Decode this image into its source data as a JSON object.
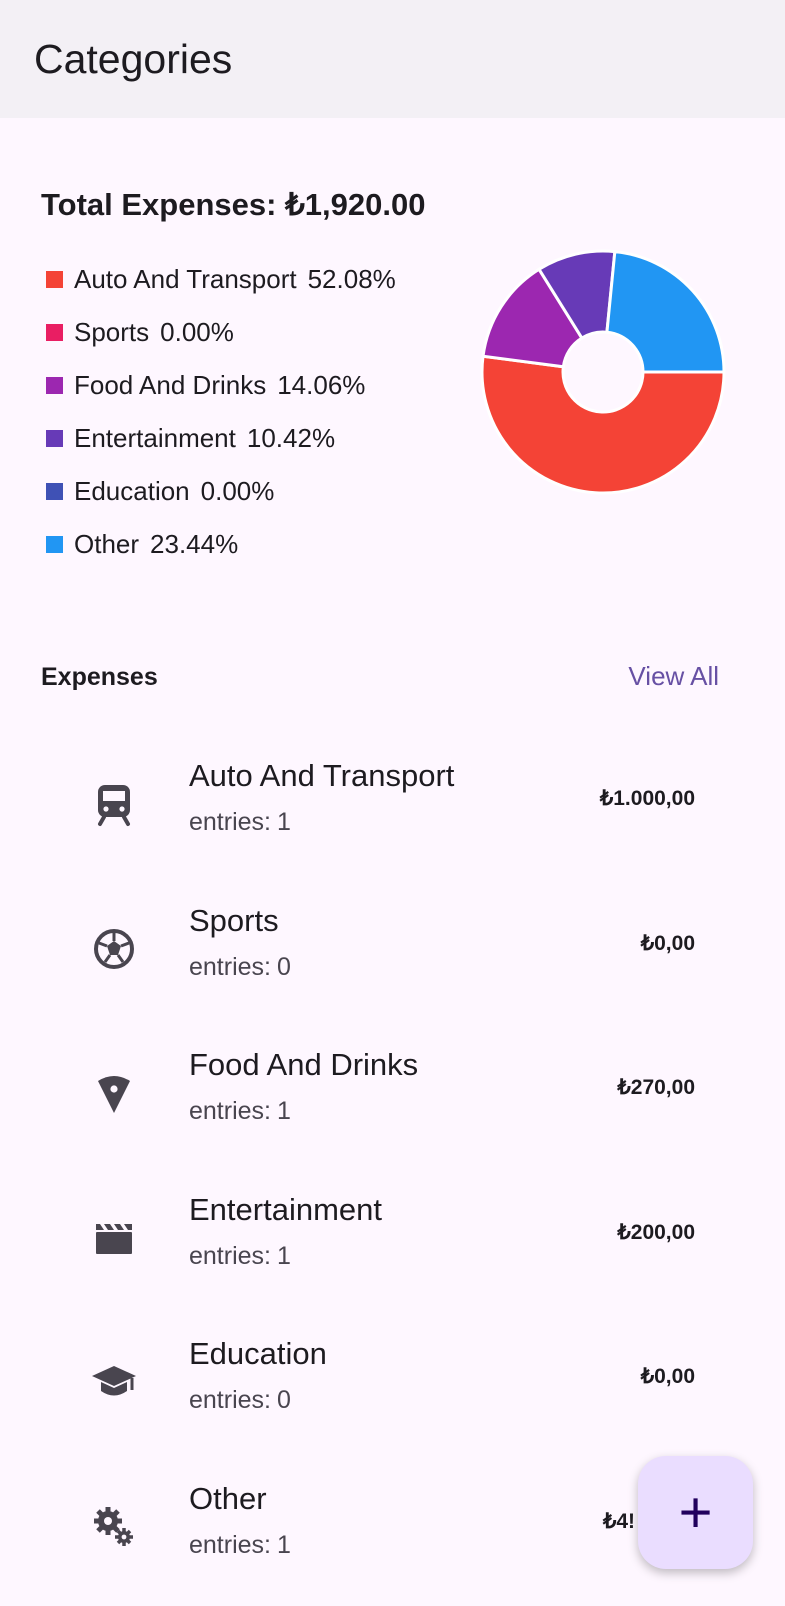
{
  "app_bar": {
    "title": "Categories"
  },
  "summary": {
    "label": "Total Expenses:",
    "total": "₺1,920.00"
  },
  "colors": {
    "auto": "#f44336",
    "sports": "#e91e63",
    "food": "#9c27b0",
    "entertainment": "#673ab7",
    "education": "#3f51b5",
    "other": "#2196f3",
    "accent": "#6750a4",
    "fab_background": "#eaddff"
  },
  "legend": [
    {
      "name": "Auto And Transport",
      "percent": "52.08%",
      "color": "#f44336"
    },
    {
      "name": "Sports",
      "percent": "0.00%",
      "color": "#e91e63"
    },
    {
      "name": "Food And Drinks",
      "percent": "14.06%",
      "color": "#9c27b0"
    },
    {
      "name": "Entertainment",
      "percent": "10.42%",
      "color": "#673ab7"
    },
    {
      "name": "Education",
      "percent": "0.00%",
      "color": "#3f51b5"
    },
    {
      "name": "Other",
      "percent": "23.44%",
      "color": "#2196f3"
    }
  ],
  "chart_data": {
    "type": "pie",
    "categories": [
      "Auto And Transport",
      "Sports",
      "Food And Drinks",
      "Entertainment",
      "Education",
      "Other"
    ],
    "values": [
      52.08,
      0.0,
      14.06,
      10.42,
      0.0,
      23.44
    ],
    "colors": [
      "#f44336",
      "#e91e63",
      "#9c27b0",
      "#673ab7",
      "#3f51b5",
      "#2196f3"
    ],
    "hole": true,
    "legend": "left"
  },
  "expenses": {
    "title": "Expenses",
    "view_all": "View All",
    "entries_label": "entries:",
    "items": [
      {
        "name": "Auto And Transport",
        "entries": "1",
        "amount": "₺1.000,00",
        "icon": "train-icon"
      },
      {
        "name": "Sports",
        "entries": "0",
        "amount": "₺0,00",
        "icon": "soccer-ball-icon"
      },
      {
        "name": "Food And Drinks",
        "entries": "1",
        "amount": "₺270,00",
        "icon": "pizza-icon"
      },
      {
        "name": "Entertainment",
        "entries": "1",
        "amount": "₺200,00",
        "icon": "clapperboard-icon"
      },
      {
        "name": "Education",
        "entries": "0",
        "amount": "₺0,00",
        "icon": "graduation-cap-icon"
      },
      {
        "name": "Other",
        "entries": "1",
        "amount": "₺4!",
        "icon": "gears-icon"
      }
    ]
  },
  "fab": {
    "label": "+",
    "icon": "add-icon"
  }
}
